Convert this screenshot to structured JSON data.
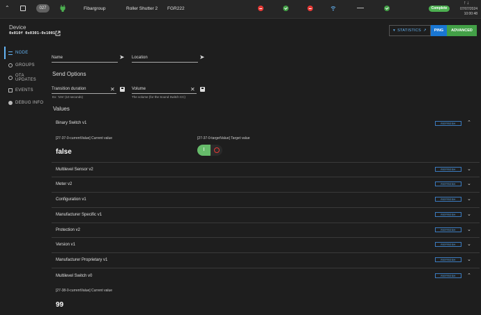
{
  "top_row": {
    "node_id": "027",
    "manufacturer": "Fibargroup",
    "product": "Roller Shutter 2",
    "model": "FGR222",
    "dash": "—",
    "status": "Complete",
    "date": "07/07/2024",
    "time": "10:00:48",
    "sort_arrows": "↑↓"
  },
  "header": {
    "label": "Device",
    "device_id": "0x010f 0x0301-0x1001",
    "buttons": {
      "statistics": "STATISTICS",
      "ping": "PING",
      "advanced": "ADVANCED"
    }
  },
  "sidebar": {
    "items": [
      {
        "label": "NODE",
        "icon": "list-icon"
      },
      {
        "label": "GROUPS",
        "icon": "groups-icon"
      },
      {
        "label": "OTA UPDATES",
        "icon": "upload-icon"
      },
      {
        "label": "EVENTS",
        "icon": "events-icon"
      },
      {
        "label": "DEBUG INFO",
        "icon": "bug-icon"
      }
    ]
  },
  "fields": {
    "name_label": "Name",
    "location_label": "Location",
    "send_options_title": "Send Options",
    "transition_label": "Transition duration",
    "transition_hint": "Ex: '10s' (10 seconds)",
    "volume_label": "Volume",
    "volume_hint": "The volume (for the Sound Switch CC)"
  },
  "values": {
    "title": "Values",
    "refresh_label": "REFRESH",
    "sections": [
      {
        "name": "Binary Switch v1"
      },
      {
        "name": "Multilevel Sensor v2"
      },
      {
        "name": "Meter v2"
      },
      {
        "name": "Configuration v1"
      },
      {
        "name": "Manufacturer Specific v1"
      },
      {
        "name": "Protection v2"
      },
      {
        "name": "Version v1"
      },
      {
        "name": "Manufacturer Proprietary v1"
      },
      {
        "name": "Multilevel Switch v0"
      }
    ],
    "binary_current_label": "[27-37-0-currentValue] Current value",
    "binary_current_value": "false",
    "binary_target_label": "[27-37-0-targetValue] Target value",
    "toggle_on_glyph": "I",
    "multilevel_current_label": "[27-38-0-currentValue] Current value",
    "multilevel_current_value": "99"
  },
  "colors": {
    "accent_blue": "#64b5f6",
    "ping_blue": "#1976d2",
    "green": "#43a047",
    "red": "#e53935"
  }
}
